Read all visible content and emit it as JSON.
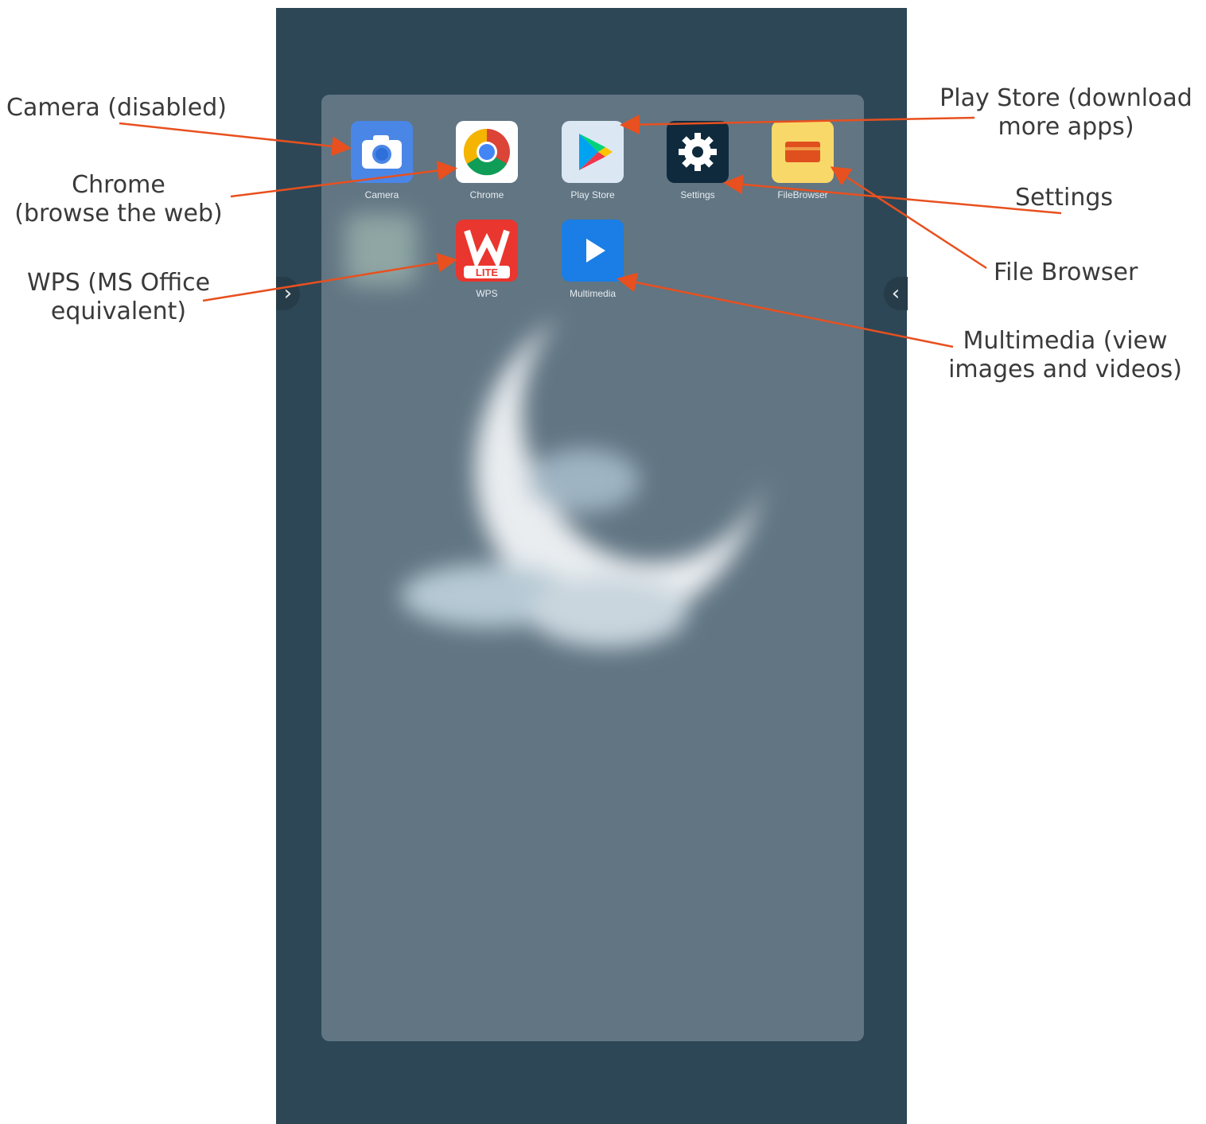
{
  "apps": {
    "camera": "Camera",
    "chrome": "Chrome",
    "playstore": "Play Store",
    "settings": "Settings",
    "filebrowser": "FileBrowser",
    "wps": "WPS",
    "wps_badge": "LITE",
    "multimedia": "Multimedia"
  },
  "annotations": {
    "camera": "Camera (disabled)",
    "chrome_line1": "Chrome",
    "chrome_line2": "(browse the web)",
    "wps_line1": "WPS (MS Office",
    "wps_line2": "equivalent)",
    "playstore_line1": "Play Store (download",
    "playstore_line2": "more apps)",
    "settings": "Settings",
    "filebrowser": "File Browser",
    "multimedia_line1": "Multimedia (view",
    "multimedia_line2": "images and videos)"
  },
  "colors": {
    "annotation_arrow": "#e8501f",
    "device_frame": "#2d4756",
    "drawer_bg": "#617583"
  }
}
